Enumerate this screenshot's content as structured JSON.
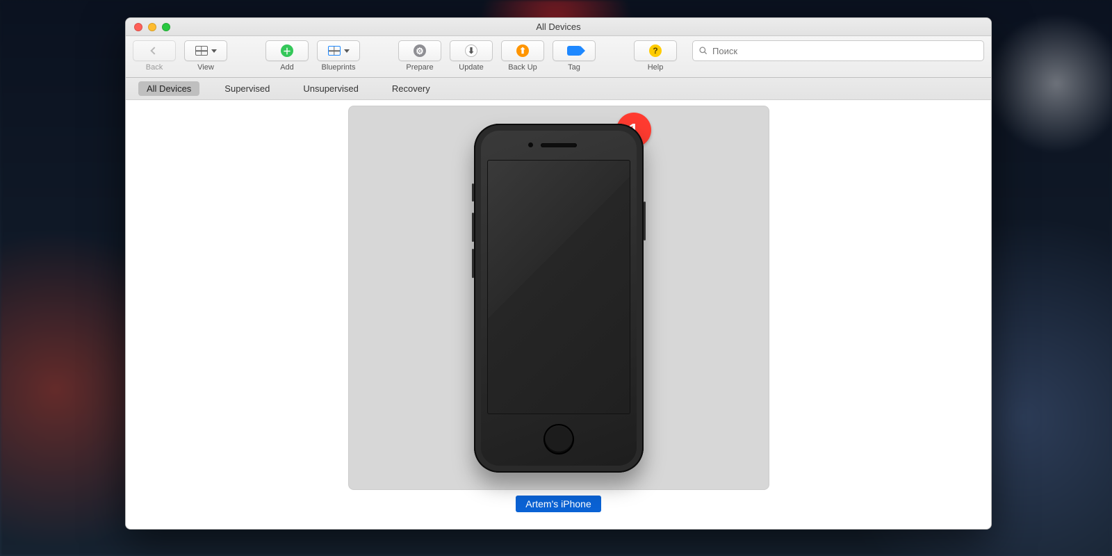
{
  "window_title": "All Devices",
  "toolbar": {
    "back_label": "Back",
    "view_label": "View",
    "add_label": "Add",
    "blueprints_label": "Blueprints",
    "prepare_label": "Prepare",
    "update_label": "Update",
    "backup_label": "Back Up",
    "tag_label": "Tag",
    "help_label": "Help"
  },
  "search": {
    "placeholder": "Поиск",
    "value": ""
  },
  "scope": {
    "items": [
      {
        "label": "All Devices",
        "selected": true
      },
      {
        "label": "Supervised",
        "selected": false
      },
      {
        "label": "Unsupervised",
        "selected": false
      },
      {
        "label": "Recovery",
        "selected": false
      }
    ]
  },
  "device": {
    "name": "Artem's iPhone",
    "badge_count": "1"
  },
  "colors": {
    "badge": "#ff3b30",
    "selection": "#0a62d4"
  }
}
